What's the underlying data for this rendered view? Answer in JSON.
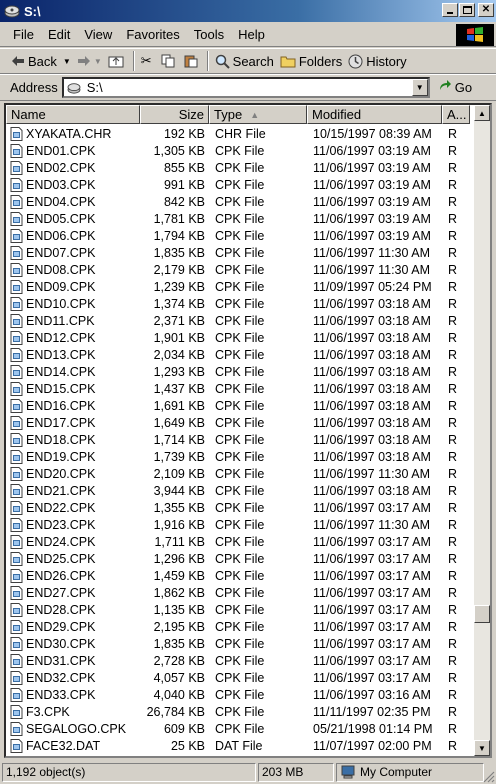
{
  "window": {
    "title": "S:\\"
  },
  "menu": [
    {
      "label": "File"
    },
    {
      "label": "Edit"
    },
    {
      "label": "View"
    },
    {
      "label": "Favorites"
    },
    {
      "label": "Tools"
    },
    {
      "label": "Help"
    }
  ],
  "toolbar": {
    "back_label": "Back",
    "search_label": "Search",
    "folders_label": "Folders",
    "history_label": "History"
  },
  "address": {
    "label": "Address",
    "value": "S:\\",
    "go_label": "Go"
  },
  "columns": {
    "name": "Name",
    "size": "Size",
    "type": "Type",
    "modified": "Modified",
    "attr": "A..."
  },
  "files": [
    {
      "name": "XYAKATA.CHR",
      "size": "192 KB",
      "type": "CHR File",
      "modified": "10/15/1997 08:39 AM",
      "attr": "R"
    },
    {
      "name": "END01.CPK",
      "size": "1,305 KB",
      "type": "CPK File",
      "modified": "11/06/1997 03:19 AM",
      "attr": "R"
    },
    {
      "name": "END02.CPK",
      "size": "855 KB",
      "type": "CPK File",
      "modified": "11/06/1997 03:19 AM",
      "attr": "R"
    },
    {
      "name": "END03.CPK",
      "size": "991 KB",
      "type": "CPK File",
      "modified": "11/06/1997 03:19 AM",
      "attr": "R"
    },
    {
      "name": "END04.CPK",
      "size": "842 KB",
      "type": "CPK File",
      "modified": "11/06/1997 03:19 AM",
      "attr": "R"
    },
    {
      "name": "END05.CPK",
      "size": "1,781 KB",
      "type": "CPK File",
      "modified": "11/06/1997 03:19 AM",
      "attr": "R"
    },
    {
      "name": "END06.CPK",
      "size": "1,794 KB",
      "type": "CPK File",
      "modified": "11/06/1997 03:19 AM",
      "attr": "R"
    },
    {
      "name": "END07.CPK",
      "size": "1,835 KB",
      "type": "CPK File",
      "modified": "11/06/1997 11:30 AM",
      "attr": "R"
    },
    {
      "name": "END08.CPK",
      "size": "2,179 KB",
      "type": "CPK File",
      "modified": "11/06/1997 11:30 AM",
      "attr": "R"
    },
    {
      "name": "END09.CPK",
      "size": "1,239 KB",
      "type": "CPK File",
      "modified": "11/09/1997 05:24 PM",
      "attr": "R"
    },
    {
      "name": "END10.CPK",
      "size": "1,374 KB",
      "type": "CPK File",
      "modified": "11/06/1997 03:18 AM",
      "attr": "R"
    },
    {
      "name": "END11.CPK",
      "size": "2,371 KB",
      "type": "CPK File",
      "modified": "11/06/1997 03:18 AM",
      "attr": "R"
    },
    {
      "name": "END12.CPK",
      "size": "1,901 KB",
      "type": "CPK File",
      "modified": "11/06/1997 03:18 AM",
      "attr": "R"
    },
    {
      "name": "END13.CPK",
      "size": "2,034 KB",
      "type": "CPK File",
      "modified": "11/06/1997 03:18 AM",
      "attr": "R"
    },
    {
      "name": "END14.CPK",
      "size": "1,293 KB",
      "type": "CPK File",
      "modified": "11/06/1997 03:18 AM",
      "attr": "R"
    },
    {
      "name": "END15.CPK",
      "size": "1,437 KB",
      "type": "CPK File",
      "modified": "11/06/1997 03:18 AM",
      "attr": "R"
    },
    {
      "name": "END16.CPK",
      "size": "1,691 KB",
      "type": "CPK File",
      "modified": "11/06/1997 03:18 AM",
      "attr": "R"
    },
    {
      "name": "END17.CPK",
      "size": "1,649 KB",
      "type": "CPK File",
      "modified": "11/06/1997 03:18 AM",
      "attr": "R"
    },
    {
      "name": "END18.CPK",
      "size": "1,714 KB",
      "type": "CPK File",
      "modified": "11/06/1997 03:18 AM",
      "attr": "R"
    },
    {
      "name": "END19.CPK",
      "size": "1,739 KB",
      "type": "CPK File",
      "modified": "11/06/1997 03:18 AM",
      "attr": "R"
    },
    {
      "name": "END20.CPK",
      "size": "2,109 KB",
      "type": "CPK File",
      "modified": "11/06/1997 11:30 AM",
      "attr": "R"
    },
    {
      "name": "END21.CPK",
      "size": "3,944 KB",
      "type": "CPK File",
      "modified": "11/06/1997 03:18 AM",
      "attr": "R"
    },
    {
      "name": "END22.CPK",
      "size": "1,355 KB",
      "type": "CPK File",
      "modified": "11/06/1997 03:17 AM",
      "attr": "R"
    },
    {
      "name": "END23.CPK",
      "size": "1,916 KB",
      "type": "CPK File",
      "modified": "11/06/1997 11:30 AM",
      "attr": "R"
    },
    {
      "name": "END24.CPK",
      "size": "1,711 KB",
      "type": "CPK File",
      "modified": "11/06/1997 03:17 AM",
      "attr": "R"
    },
    {
      "name": "END25.CPK",
      "size": "1,296 KB",
      "type": "CPK File",
      "modified": "11/06/1997 03:17 AM",
      "attr": "R"
    },
    {
      "name": "END26.CPK",
      "size": "1,459 KB",
      "type": "CPK File",
      "modified": "11/06/1997 03:17 AM",
      "attr": "R"
    },
    {
      "name": "END27.CPK",
      "size": "1,862 KB",
      "type": "CPK File",
      "modified": "11/06/1997 03:17 AM",
      "attr": "R"
    },
    {
      "name": "END28.CPK",
      "size": "1,135 KB",
      "type": "CPK File",
      "modified": "11/06/1997 03:17 AM",
      "attr": "R"
    },
    {
      "name": "END29.CPK",
      "size": "2,195 KB",
      "type": "CPK File",
      "modified": "11/06/1997 03:17 AM",
      "attr": "R"
    },
    {
      "name": "END30.CPK",
      "size": "1,835 KB",
      "type": "CPK File",
      "modified": "11/06/1997 03:17 AM",
      "attr": "R"
    },
    {
      "name": "END31.CPK",
      "size": "2,728 KB",
      "type": "CPK File",
      "modified": "11/06/1997 03:17 AM",
      "attr": "R"
    },
    {
      "name": "END32.CPK",
      "size": "4,057 KB",
      "type": "CPK File",
      "modified": "11/06/1997 03:17 AM",
      "attr": "R"
    },
    {
      "name": "END33.CPK",
      "size": "4,040 KB",
      "type": "CPK File",
      "modified": "11/06/1997 03:16 AM",
      "attr": "R"
    },
    {
      "name": "F3.CPK",
      "size": "26,784 KB",
      "type": "CPK File",
      "modified": "11/11/1997 02:35 PM",
      "attr": "R"
    },
    {
      "name": "SEGALOGO.CPK",
      "size": "609 KB",
      "type": "CPK File",
      "modified": "05/21/1998 01:14 PM",
      "attr": "R"
    },
    {
      "name": "FACE32.DAT",
      "size": "25 KB",
      "type": "DAT File",
      "modified": "11/07/1997 02:00 PM",
      "attr": "R"
    }
  ],
  "status": {
    "objects": "1,192 object(s)",
    "size": "203 MB",
    "location": "My Computer"
  }
}
